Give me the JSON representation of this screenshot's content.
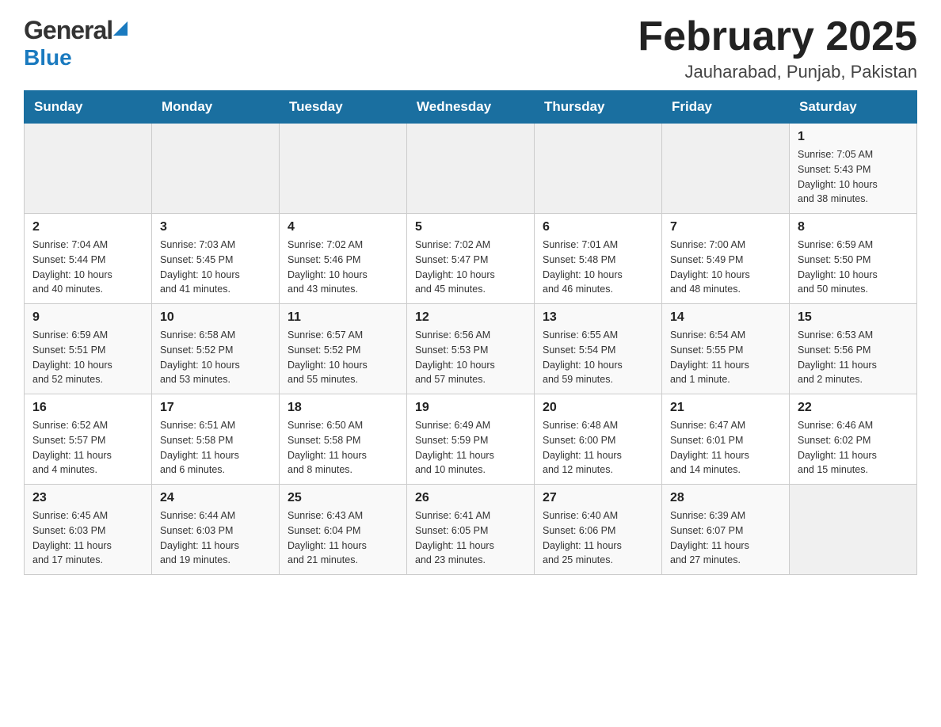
{
  "header": {
    "logo_general": "General",
    "logo_blue": "Blue",
    "month_title": "February 2025",
    "location": "Jauharabad, Punjab, Pakistan"
  },
  "days_of_week": [
    "Sunday",
    "Monday",
    "Tuesday",
    "Wednesday",
    "Thursday",
    "Friday",
    "Saturday"
  ],
  "weeks": [
    {
      "cells": [
        {
          "day": "",
          "info": ""
        },
        {
          "day": "",
          "info": ""
        },
        {
          "day": "",
          "info": ""
        },
        {
          "day": "",
          "info": ""
        },
        {
          "day": "",
          "info": ""
        },
        {
          "day": "",
          "info": ""
        },
        {
          "day": "1",
          "info": "Sunrise: 7:05 AM\nSunset: 5:43 PM\nDaylight: 10 hours\nand 38 minutes."
        }
      ]
    },
    {
      "cells": [
        {
          "day": "2",
          "info": "Sunrise: 7:04 AM\nSunset: 5:44 PM\nDaylight: 10 hours\nand 40 minutes."
        },
        {
          "day": "3",
          "info": "Sunrise: 7:03 AM\nSunset: 5:45 PM\nDaylight: 10 hours\nand 41 minutes."
        },
        {
          "day": "4",
          "info": "Sunrise: 7:02 AM\nSunset: 5:46 PM\nDaylight: 10 hours\nand 43 minutes."
        },
        {
          "day": "5",
          "info": "Sunrise: 7:02 AM\nSunset: 5:47 PM\nDaylight: 10 hours\nand 45 minutes."
        },
        {
          "day": "6",
          "info": "Sunrise: 7:01 AM\nSunset: 5:48 PM\nDaylight: 10 hours\nand 46 minutes."
        },
        {
          "day": "7",
          "info": "Sunrise: 7:00 AM\nSunset: 5:49 PM\nDaylight: 10 hours\nand 48 minutes."
        },
        {
          "day": "8",
          "info": "Sunrise: 6:59 AM\nSunset: 5:50 PM\nDaylight: 10 hours\nand 50 minutes."
        }
      ]
    },
    {
      "cells": [
        {
          "day": "9",
          "info": "Sunrise: 6:59 AM\nSunset: 5:51 PM\nDaylight: 10 hours\nand 52 minutes."
        },
        {
          "day": "10",
          "info": "Sunrise: 6:58 AM\nSunset: 5:52 PM\nDaylight: 10 hours\nand 53 minutes."
        },
        {
          "day": "11",
          "info": "Sunrise: 6:57 AM\nSunset: 5:52 PM\nDaylight: 10 hours\nand 55 minutes."
        },
        {
          "day": "12",
          "info": "Sunrise: 6:56 AM\nSunset: 5:53 PM\nDaylight: 10 hours\nand 57 minutes."
        },
        {
          "day": "13",
          "info": "Sunrise: 6:55 AM\nSunset: 5:54 PM\nDaylight: 10 hours\nand 59 minutes."
        },
        {
          "day": "14",
          "info": "Sunrise: 6:54 AM\nSunset: 5:55 PM\nDaylight: 11 hours\nand 1 minute."
        },
        {
          "day": "15",
          "info": "Sunrise: 6:53 AM\nSunset: 5:56 PM\nDaylight: 11 hours\nand 2 minutes."
        }
      ]
    },
    {
      "cells": [
        {
          "day": "16",
          "info": "Sunrise: 6:52 AM\nSunset: 5:57 PM\nDaylight: 11 hours\nand 4 minutes."
        },
        {
          "day": "17",
          "info": "Sunrise: 6:51 AM\nSunset: 5:58 PM\nDaylight: 11 hours\nand 6 minutes."
        },
        {
          "day": "18",
          "info": "Sunrise: 6:50 AM\nSunset: 5:58 PM\nDaylight: 11 hours\nand 8 minutes."
        },
        {
          "day": "19",
          "info": "Sunrise: 6:49 AM\nSunset: 5:59 PM\nDaylight: 11 hours\nand 10 minutes."
        },
        {
          "day": "20",
          "info": "Sunrise: 6:48 AM\nSunset: 6:00 PM\nDaylight: 11 hours\nand 12 minutes."
        },
        {
          "day": "21",
          "info": "Sunrise: 6:47 AM\nSunset: 6:01 PM\nDaylight: 11 hours\nand 14 minutes."
        },
        {
          "day": "22",
          "info": "Sunrise: 6:46 AM\nSunset: 6:02 PM\nDaylight: 11 hours\nand 15 minutes."
        }
      ]
    },
    {
      "cells": [
        {
          "day": "23",
          "info": "Sunrise: 6:45 AM\nSunset: 6:03 PM\nDaylight: 11 hours\nand 17 minutes."
        },
        {
          "day": "24",
          "info": "Sunrise: 6:44 AM\nSunset: 6:03 PM\nDaylight: 11 hours\nand 19 minutes."
        },
        {
          "day": "25",
          "info": "Sunrise: 6:43 AM\nSunset: 6:04 PM\nDaylight: 11 hours\nand 21 minutes."
        },
        {
          "day": "26",
          "info": "Sunrise: 6:41 AM\nSunset: 6:05 PM\nDaylight: 11 hours\nand 23 minutes."
        },
        {
          "day": "27",
          "info": "Sunrise: 6:40 AM\nSunset: 6:06 PM\nDaylight: 11 hours\nand 25 minutes."
        },
        {
          "day": "28",
          "info": "Sunrise: 6:39 AM\nSunset: 6:07 PM\nDaylight: 11 hours\nand 27 minutes."
        },
        {
          "day": "",
          "info": ""
        }
      ]
    }
  ]
}
